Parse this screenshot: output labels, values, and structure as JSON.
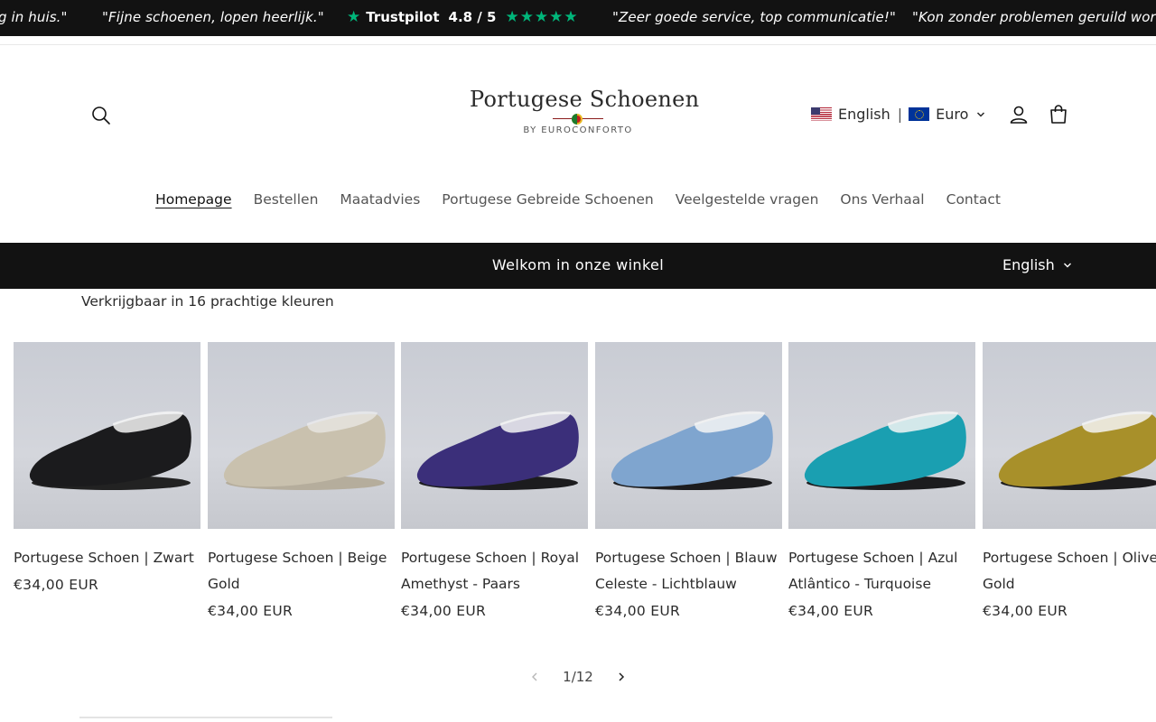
{
  "ticker": {
    "review_1": "g in huis.\"",
    "review_2": "\"Fijne schoenen, lopen heerlijk.\"",
    "trustpilot_label": "Trustpilot",
    "trustpilot_score": "4.8 / 5",
    "trustpilot_stars": "★★★★★",
    "review_3": "\"Zeer goede service, top communicatie!\"",
    "review_4": "\"Kon zonder problemen geruild worden"
  },
  "header": {
    "logo_title": "Portugese Schoenen",
    "logo_subtitle": "BY EUROCONFORTO",
    "language": "English",
    "separator": "|",
    "currency": "Euro"
  },
  "nav": {
    "items": [
      {
        "label": "Homepage",
        "active": true
      },
      {
        "label": "Bestellen"
      },
      {
        "label": "Maatadvies"
      },
      {
        "label": "Portugese Gebreide Schoenen"
      },
      {
        "label": "Veelgestelde vragen"
      },
      {
        "label": "Ons Verhaal"
      },
      {
        "label": "Contact"
      }
    ]
  },
  "announcement": {
    "welcome": "Welkom in onze winkel",
    "language": "English"
  },
  "section": {
    "availability": "Verkrijgbaar in 16 prachtige kleuren"
  },
  "products": [
    {
      "title": "Portugese Schoen | Zwart",
      "price": "€34,00 EUR",
      "color": "#1b1b1d"
    },
    {
      "title": "Portugese Schoen | Beige Gold",
      "price": "€34,00 EUR",
      "color": "#c9c1ae"
    },
    {
      "title": "Portugese Schoen | Royal Amethyst - Paars",
      "price": "€34,00 EUR",
      "color": "#3b2f7a"
    },
    {
      "title": "Portugese Schoen | Blauw Celeste - Lichtblauw",
      "price": "€34,00 EUR",
      "color": "#7fa5cf"
    },
    {
      "title": "Portugese Schoen | Azul Atlântico - Turquoise",
      "price": "€34,00 EUR",
      "color": "#1a9fb1"
    },
    {
      "title": "Portugese Schoen | Olive Gold",
      "price": "€34,00 EUR",
      "color": "#a8902a"
    }
  ],
  "pager": {
    "label": "1/12"
  },
  "colors": {
    "dark_bar": "#121212",
    "trustpilot_green": "#00b67a"
  }
}
